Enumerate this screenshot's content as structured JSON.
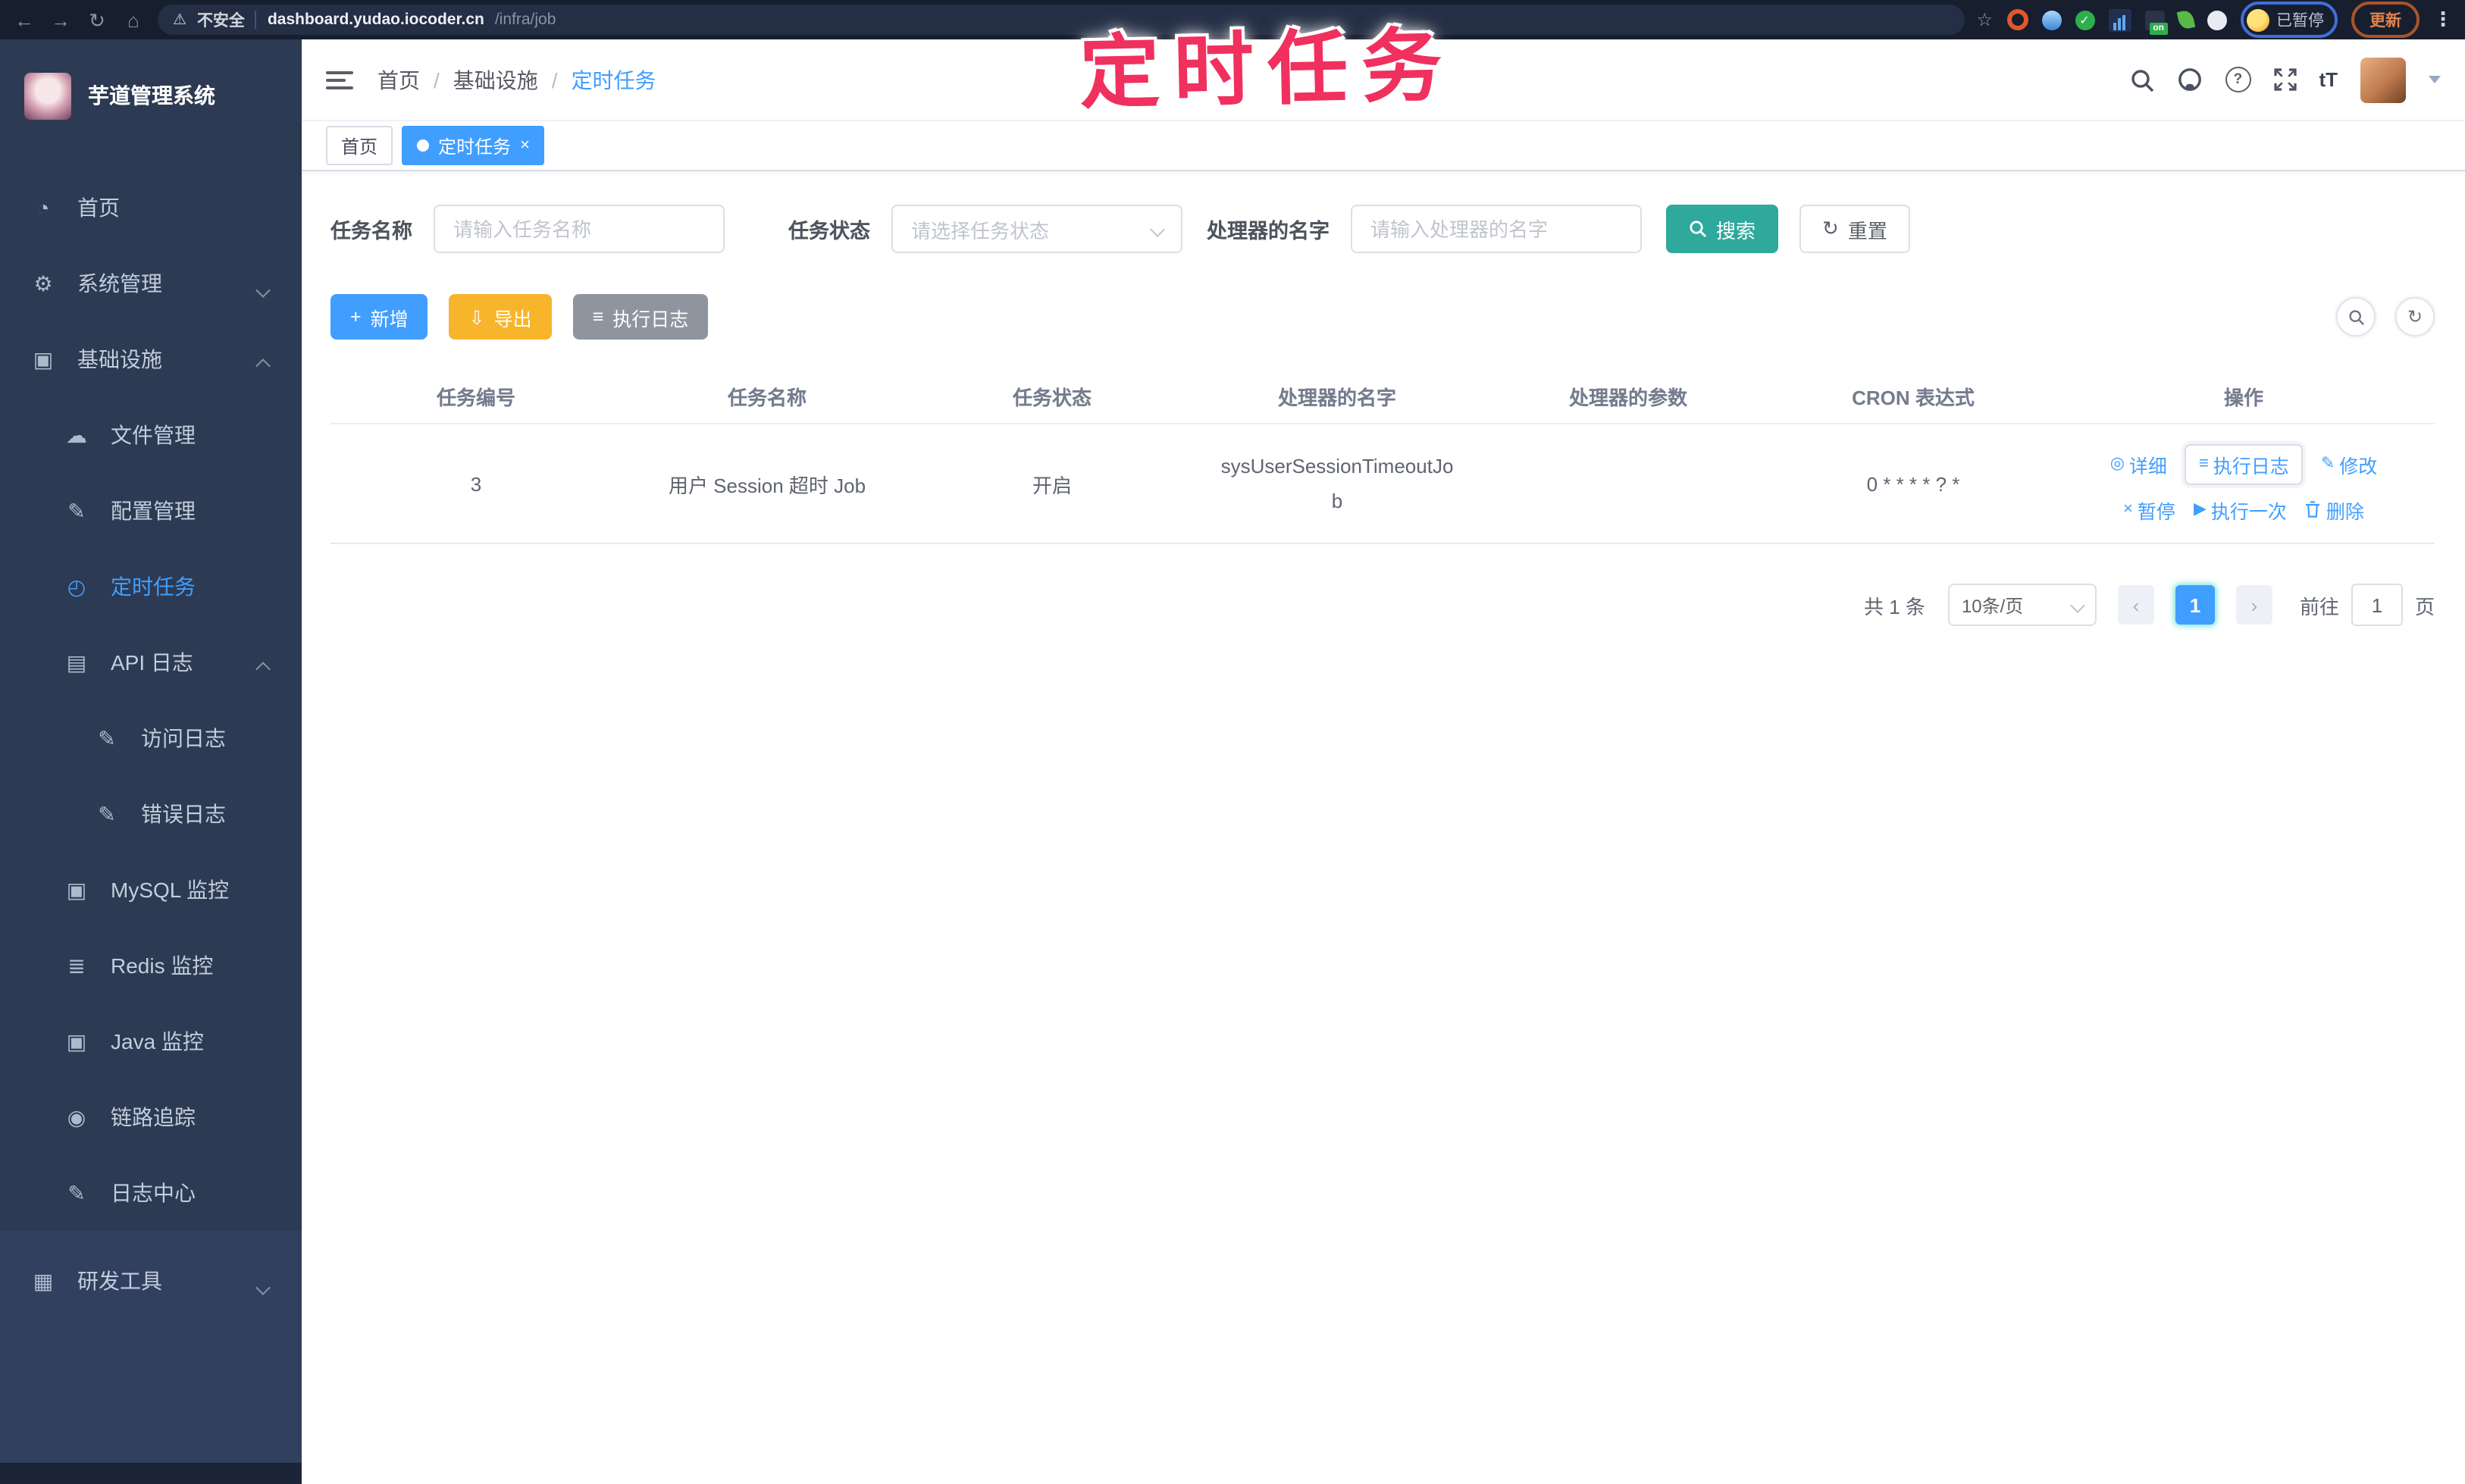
{
  "browser": {
    "security_label": "不安全",
    "url_host": "dashboard.yudao.iocoder.cn",
    "url_path": "/infra/job",
    "extension_on_badge": "on",
    "paused_badge": "已暂停",
    "update_label": "更新"
  },
  "annotation": {
    "text": "定时任务"
  },
  "sidebar": {
    "title": "芋道管理系统",
    "items": [
      {
        "label": "首页"
      },
      {
        "label": "系统管理"
      },
      {
        "label": "基础设施"
      },
      {
        "label": "文件管理"
      },
      {
        "label": "配置管理"
      },
      {
        "label": "定时任务"
      },
      {
        "label": "API 日志"
      },
      {
        "label": "访问日志"
      },
      {
        "label": "错误日志"
      },
      {
        "label": "MySQL 监控"
      },
      {
        "label": "Redis 监控"
      },
      {
        "label": "Java 监控"
      },
      {
        "label": "链路追踪"
      },
      {
        "label": "日志中心"
      },
      {
        "label": "研发工具"
      }
    ]
  },
  "breadcrumb": {
    "items": [
      "首页",
      "基础设施",
      "定时任务"
    ],
    "separator": "/"
  },
  "tags": {
    "items": [
      {
        "label": "首页"
      },
      {
        "label": "定时任务"
      }
    ]
  },
  "filters": {
    "name_label": "任务名称",
    "name_placeholder": "请输入任务名称",
    "status_label": "任务状态",
    "status_placeholder": "请选择任务状态",
    "handler_label": "处理器的名字",
    "handler_placeholder": "请输入处理器的名字",
    "search_label": "搜索",
    "reset_label": "重置"
  },
  "toolbar": {
    "add_label": "新增",
    "export_label": "导出",
    "job_log_label": "执行日志"
  },
  "table": {
    "columns": [
      "任务编号",
      "任务名称",
      "任务状态",
      "处理器的名字",
      "处理器的参数",
      "CRON 表达式",
      "操作"
    ],
    "rows": [
      {
        "id": "3",
        "name": "用户 Session 超时 Job",
        "status": "开启",
        "handler": "sysUserSessionTimeoutJob",
        "param": "",
        "cron": "0 * * * * ? *"
      }
    ],
    "row_actions": {
      "detail": "详细",
      "log": "执行日志",
      "edit": "修改",
      "pause": "暂停",
      "run_once": "执行一次",
      "delete": "删除"
    }
  },
  "pagination": {
    "total_text": "共 1 条",
    "page_size": "10条/页",
    "current_page": "1",
    "goto_label": "前往",
    "goto_value": "1",
    "page_unit": "页"
  },
  "icons": {
    "back": "←",
    "forward": "→",
    "reload": "↻",
    "home": "⌂",
    "warning": "⚠",
    "star": "☆",
    "kebab": "⋮",
    "check": "✓",
    "dashboard": "◔",
    "gear": "⚙",
    "monitor": "▣",
    "cloud": "☁",
    "edit": "✎",
    "timer": "◴",
    "log": "▤",
    "layers": "≣",
    "eye": "◉",
    "toolbox": "▦",
    "plus": "+",
    "download": "⇩",
    "list": "≡",
    "refresh": "↻",
    "detail": "◎",
    "pause": "×",
    "play": "▶",
    "close": "×",
    "prev": "‹",
    "next": "›"
  },
  "colors": {
    "accent": "#409eff",
    "search_button": "#2ea99c",
    "export_button": "#f7b52c",
    "sidebar_bg": "#2d3a53",
    "annotation": "#f0305e"
  }
}
